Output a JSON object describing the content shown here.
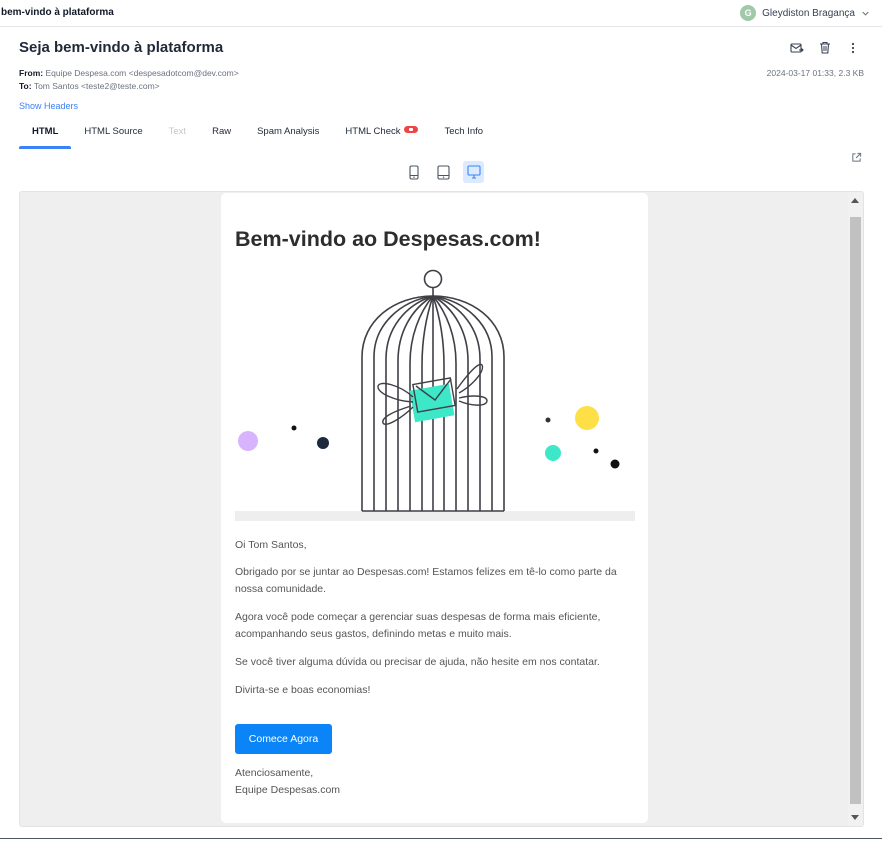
{
  "app": {
    "title": "bem-vindo à plataforma",
    "user": {
      "initial": "G",
      "name": "Gleydiston Bragança"
    }
  },
  "message": {
    "subject": "Seja bem-vindo à plataforma",
    "from_label": "From:",
    "from_value": "Equipe Despesa.com <despesadotcom@dev.com>",
    "to_label": "To:",
    "to_value": "Tom Santos <teste2@teste.com>",
    "date_size": "2024-03-17 01:33, 2.3 KB",
    "show_headers": "Show Headers"
  },
  "actions": {
    "icons": [
      "release-icon",
      "trash-icon",
      "more-vertical-icon"
    ]
  },
  "tabs": [
    {
      "label": "HTML",
      "active": true
    },
    {
      "label": "HTML Source"
    },
    {
      "label": "Text",
      "disabled": true
    },
    {
      "label": "Raw"
    },
    {
      "label": "Spam Analysis"
    },
    {
      "label": "HTML Check",
      "badge_color": "#ef4444"
    },
    {
      "label": "Tech Info"
    }
  ],
  "device_toggle": {
    "options": [
      "phone-icon",
      "tablet-icon",
      "desktop-icon"
    ],
    "selected": "desktop-icon"
  },
  "email": {
    "heading": "Bem-vindo ao Despesas.com!",
    "greeting": "Oi Tom Santos,",
    "p1": "Obrigado por se juntar ao Despesas.com! Estamos felizes em tê-lo como parte da nossa comunidade.",
    "p2": "Agora você pode começar a gerenciar suas despesas de forma mais eficiente, acompanhando seus gastos, definindo metas e muito mais.",
    "p3": "Se você tiver alguma dúvida ou precisar de ajuda, não hesite em nos contatar.",
    "p4": "Divirta-se e boas economias!",
    "cta": "Comece Agora",
    "signoff_1": "Atenciosamente,",
    "signoff_2": "Equipe Despesas.com"
  },
  "colors": {
    "accent": "#3b82f6",
    "cta": "#0b84f7",
    "illustration_teal": "#3ce8c8",
    "illustration_yellow": "#fde047",
    "illustration_lilac": "#d8b4fe",
    "illustration_navy": "#1e293b"
  }
}
